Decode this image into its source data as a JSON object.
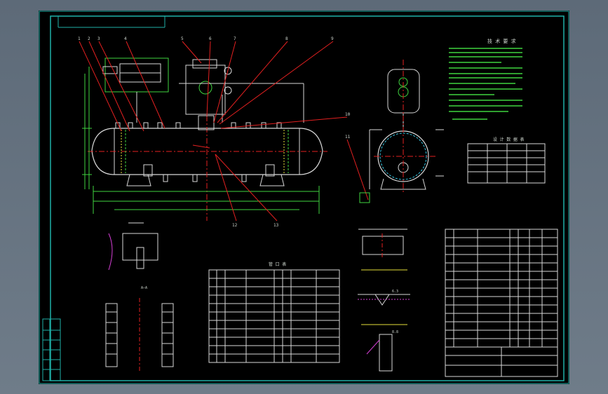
{
  "drawing": {
    "notes_heading": "技 术 要 求",
    "table_center_heading": "管 口 表",
    "table_right_heading": "设 计 数 据 表",
    "leader_numbers": [
      "1",
      "2",
      "3",
      "4",
      "5",
      "6",
      "7",
      "8",
      "9",
      "10",
      "11",
      "12",
      "13"
    ],
    "section_label": "A—A",
    "dims": [
      "6.3",
      "8.8"
    ],
    "colors": {
      "frame": "#1fb0a8",
      "line": "#d8d8d8",
      "leader": "#e32020",
      "equipment": "#3fd43f",
      "cyan": "#35c9e6",
      "yellow": "#e6e03a",
      "magenta": "#d43fd4",
      "text": "#cfd6cf"
    }
  }
}
